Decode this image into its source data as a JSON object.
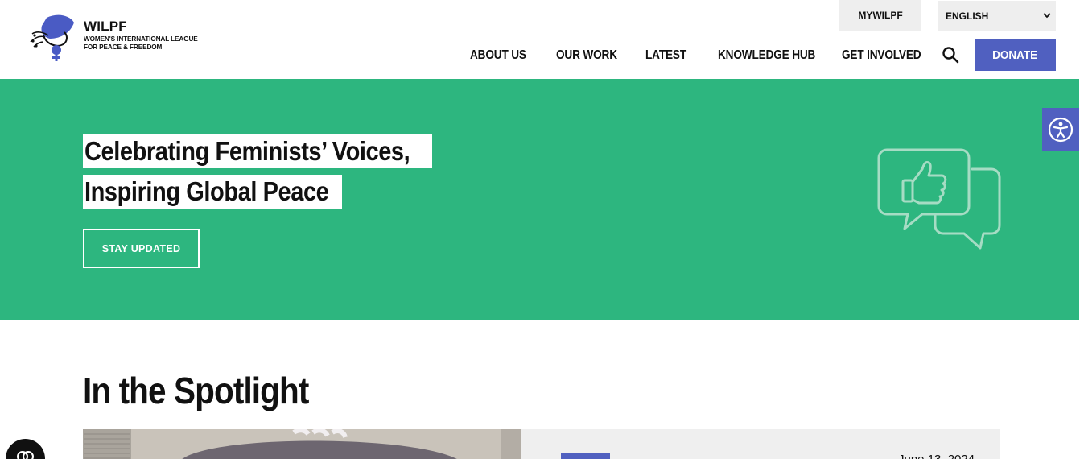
{
  "brand": {
    "title": "WILPF",
    "subtitle": "WOMEN'S INTERNATIONAL LEAGUE FOR PEACE & FREEDOM",
    "logo_color": "#4a5bc4"
  },
  "topbar": {
    "mywilpf": "MYWILPF",
    "language": "ENGLISH"
  },
  "nav": {
    "items": [
      "ABOUT US",
      "OUR WORK",
      "LATEST",
      "KNOWLEDGE HUB",
      "GET INVOLVED"
    ],
    "search_icon": "search-icon",
    "donate": "DONATE"
  },
  "hero": {
    "line1": "Celebrating Feminists’ Voices,",
    "line2": "Inspiring Global Peace",
    "cta": "STAY UPDATED",
    "bg_color": "#2db67f",
    "art_icon": "thumbs-up-chat-icon"
  },
  "accessibility": {
    "icon": "accessibility-icon"
  },
  "spotlight": {
    "title": "In the Spotlight",
    "date_partial": "June 13, 2024"
  },
  "colors": {
    "accent": "#5060c0",
    "green": "#2db67f"
  }
}
